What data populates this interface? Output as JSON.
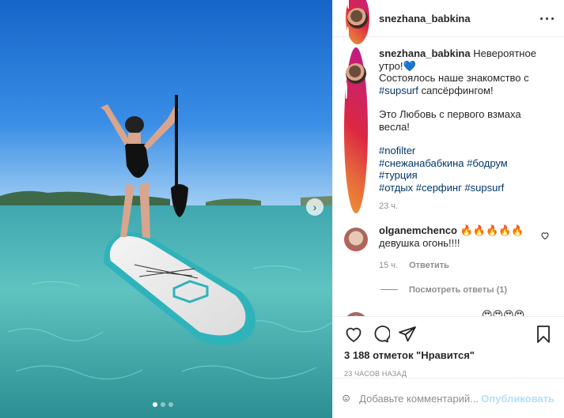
{
  "post": {
    "username": "snezhana_babkina",
    "more_icon": "ellipsis-icon"
  },
  "caption": {
    "username": "snezhana_babkina",
    "line1_text": "Невероятное утро!",
    "line1_emoji": "💙",
    "line2_pre": "Состоялось наше знакомство с ",
    "line2_tag": "#supsurf",
    "line2_post": " сапсёрфингом!",
    "line3": "Это Любовь с первого взмаха весла!",
    "tags_line1": "#nofilter",
    "tags_line2": "#снежанабабкина #бодрум #турция",
    "tags_line3": "#отдых #серфинг #supsurf",
    "time": "23 ч."
  },
  "comment1": {
    "username": "olganemchenco",
    "emojis": "🔥🔥🔥🔥🔥",
    "text": "девушка огонь!!!!",
    "time": "15 ч.",
    "reply_label": "Ответить",
    "view_replies": "Посмотреть ответы (1)"
  },
  "comment2": {
    "emojis": "😍😍😍😍"
  },
  "actions": {
    "likes": "3 188 отметок \"Нравится\"",
    "post_time": "23 ЧАСОВ НАЗАД"
  },
  "add_comment": {
    "placeholder": "Добавьте комментарий...",
    "post_label": "Опубликовать"
  },
  "carousel": {
    "total_slides": 3,
    "active_slide": 1
  },
  "colors": {
    "hashtag": "#00376b",
    "post_button_disabled": "#b2dffc",
    "muted_text": "#8e8e8e"
  }
}
